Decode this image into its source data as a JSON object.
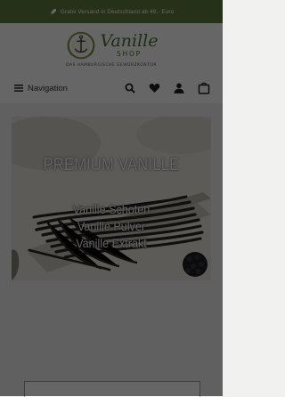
{
  "announcement": {
    "text": "Gratis Versand in Deutschland ab 49,- Euro",
    "icon": "rocket-icon"
  },
  "logo": {
    "main": "Vanille",
    "sub": "SHOP",
    "tagline": "DAS HAMBURGISCHE GEWÜRZKONTOR"
  },
  "nav": {
    "menu_label": "Navigation",
    "icons": [
      "search-icon",
      "heart-icon",
      "user-icon",
      "bag-icon"
    ]
  },
  "hero": {
    "headline": "PREMIUM VANILLE",
    "lines": [
      "Vanille Schoten",
      "Vanille Pulver",
      "Vanille Extrakt"
    ]
  },
  "colors": {
    "brand": "#4d6e2c",
    "announce_bg": "#5d7b3c",
    "overlay": "rgba(0,0,0,0.6)"
  }
}
